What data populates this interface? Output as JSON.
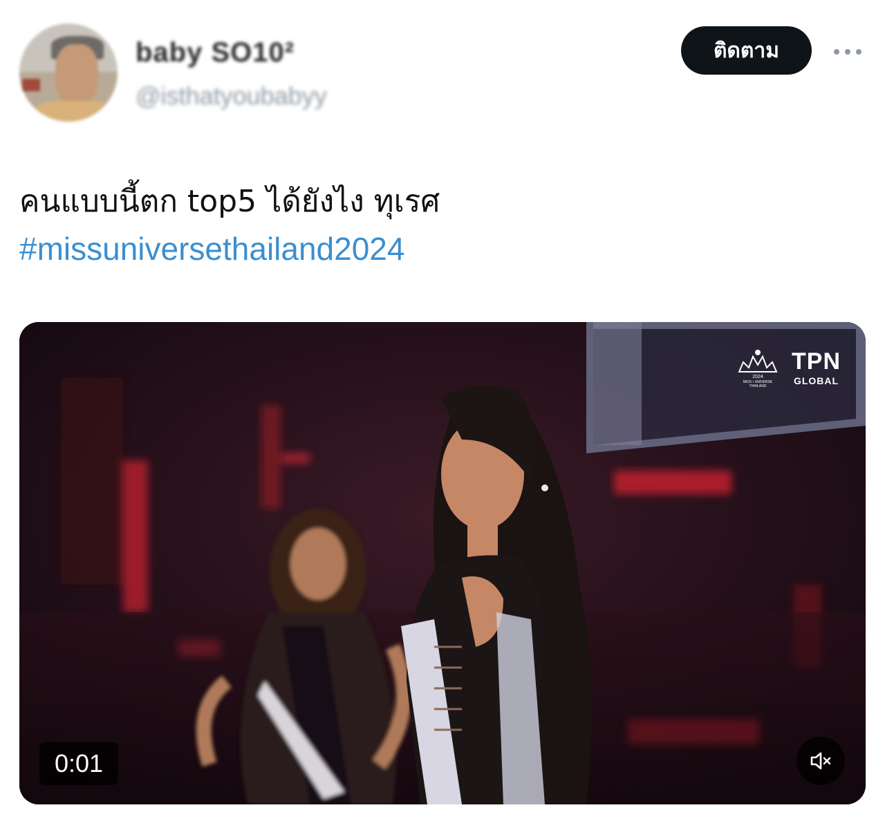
{
  "author": {
    "display_name": "baby SO10²",
    "handle": "@isthatyoubabyy"
  },
  "header": {
    "follow_label": "ติดตาม",
    "more_icon": "more-horizontal-icon"
  },
  "tweet": {
    "text": "คนแบบนี้ตก top5 ได้ยังไง ทุเรศ",
    "hashtag": "#missuniversethailand2024"
  },
  "video": {
    "time": "0:01",
    "watermark": {
      "brand_big": "TPN",
      "brand_small": "GLOBAL",
      "logo_year": "2024",
      "logo_line1": "MISS • UNIVERSE",
      "logo_line2": "THAILAND"
    },
    "mute_icon": "speaker-muted-icon"
  },
  "colors": {
    "accent_link": "#3a8fd1",
    "button_dark": "#0f1419",
    "muted_gray": "#8d98a2"
  }
}
